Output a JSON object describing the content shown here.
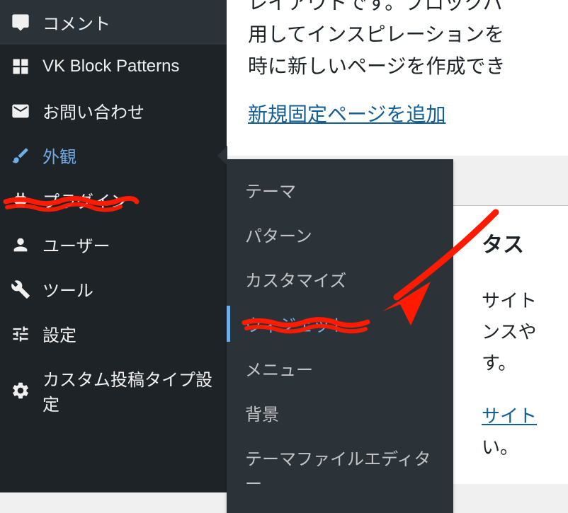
{
  "sidebar": {
    "items": [
      {
        "label": "コメント",
        "icon": "comment-icon",
        "active": false
      },
      {
        "label": "VK Block Patterns",
        "icon": "grid-icon",
        "active": false
      },
      {
        "label": "お問い合わせ",
        "icon": "mail-icon",
        "active": false
      },
      {
        "label": "外観",
        "icon": "brush-icon",
        "active": true
      },
      {
        "label": "プラグイン",
        "icon": "plug-icon",
        "active": false
      },
      {
        "label": "ユーザー",
        "icon": "user-icon",
        "active": false
      },
      {
        "label": "ツール",
        "icon": "wrench-icon",
        "active": false
      },
      {
        "label": "設定",
        "icon": "sliders-icon",
        "active": false
      },
      {
        "label": "カスタム投稿タイプ設定",
        "icon": "gear-icon",
        "active": false
      }
    ]
  },
  "submenu": {
    "items": [
      {
        "label": "テーマ",
        "current": false
      },
      {
        "label": "パターン",
        "current": false
      },
      {
        "label": "カスタマイズ",
        "current": false
      },
      {
        "label": "ウィジェット",
        "current": true
      },
      {
        "label": "メニュー",
        "current": false
      },
      {
        "label": "背景",
        "current": false
      },
      {
        "label": "テーマファイルエディター",
        "current": false
      }
    ]
  },
  "content": {
    "paragraph": "レイアウトです。ブロックパ\n用してインスピレーションを\n時に新しいページを作成でき",
    "link": "新規固定ページを追加"
  },
  "status": {
    "heading_fragment": "タス",
    "body1": "サイト",
    "body2": "ンスや",
    "body3": "す。",
    "link_fragment": "サイト",
    "body4": "い。"
  },
  "annotations": {
    "marker_color": "#ff1a00",
    "underline_appearance": true,
    "underline_widgets": true,
    "arrow": true
  }
}
